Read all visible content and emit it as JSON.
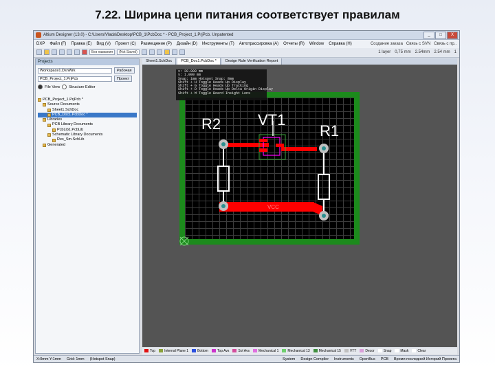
{
  "slide": {
    "title": "7.22. Ширина цепи питания соответствует правилам"
  },
  "window": {
    "title": "Altium Designer (13.0) - C:\\Users\\Vlada\\Desktop\\PCB_1\\PcbDoc * - PCB_Project_1.PrjPcb. Unpatented",
    "controls": [
      "_",
      "□",
      "X"
    ]
  },
  "menu": {
    "items": [
      "DXP",
      "Файл (F)",
      "Правка (E)",
      "Вид (V)",
      "Проект (C)",
      "Размещение (P)",
      "Дизайн (D)",
      "Инструменты (T)",
      "Автотрассировка (A)",
      "Отчеты (R)",
      "Window",
      "Справка (H)"
    ],
    "right": [
      "Создание заказа",
      "Связь с SVN",
      "Связь с пр.."
    ]
  },
  "toolbar": {
    "select1": "Без названия",
    "select2": "(Not Saved)",
    "right": [
      "1 layer",
      "0,75 mm",
      "2.54mm",
      "2.54 mm",
      "1"
    ]
  },
  "projects_panel": {
    "header": "Projects",
    "workspace_value": "Workspace1.DsnWrk",
    "workspace_button": "Рабочая",
    "project_value": "PCB_Project_1.PrjPcb",
    "project_button": "Проект",
    "view_file": "File View",
    "view_structure": "Structure Editor",
    "tree": [
      {
        "label": "PCB_Project_1.PrjPcb *",
        "indent": 0,
        "selected": false
      },
      {
        "label": "Source Documents",
        "indent": 1,
        "selected": false
      },
      {
        "label": "Sheet1.SchDoc",
        "indent": 2,
        "selected": false
      },
      {
        "label": "PCB_Doc1.PcbDoc *",
        "indent": 2,
        "selected": true
      },
      {
        "label": "Libraries",
        "indent": 1,
        "selected": false
      },
      {
        "label": "PCB Library Documents",
        "indent": 2,
        "selected": false
      },
      {
        "label": "PcbLib1.PcbLib",
        "indent": 3,
        "selected": false
      },
      {
        "label": "Schematic Library Documents",
        "indent": 2,
        "selected": false
      },
      {
        "label": "Res_Sm.SchLib",
        "indent": 3,
        "selected": false
      },
      {
        "label": "Generated",
        "indent": 1,
        "selected": false
      }
    ]
  },
  "editor": {
    "tabs": [
      {
        "label": "Sheet1.SchDoc",
        "active": false
      },
      {
        "label": "PCB_Doc1.PcbDoc *",
        "active": true
      },
      {
        "label": "Design Rule Verification Report",
        "active": false
      }
    ],
    "hud": [
      "x: 20.000 mm",
      "y: 1.000 mm",
      "Snap: 1mm Hotspot Snap: 8mm",
      "Shift + H   Toggle Heads Up Display",
      "Shift + G   Toggle Heads Up Tracking",
      "Shift + D   Toggle Heads Up Delta Origin Display",
      "Shift + M   Toggle Board Insight Lens"
    ],
    "pcb": {
      "labels": {
        "r2": "R2",
        "vt1": "VT1",
        "r1": "R1",
        "net": "VCC"
      },
      "colors": {
        "board_edge": "#1c8a1c",
        "top_layer": "#ff0000",
        "silkscreen": "#ffffff",
        "pad": "#c0c0c0",
        "via_hole": "#2a8f8f",
        "selection": "#ff00ff"
      }
    }
  },
  "layers": [
    {
      "label": "Top",
      "color": "#e01010"
    },
    {
      "label": "Internal Plane 1",
      "color": "#8aa13a"
    },
    {
      "label": "Bottom",
      "color": "#2a4fe0"
    },
    {
      "label": "Top Avs",
      "color": "#cc33cc"
    },
    {
      "label": "Sol Avs",
      "color": "#d44d9c"
    },
    {
      "label": "Mechanical 1",
      "color": "#e070e0"
    },
    {
      "label": "Mechanical 13",
      "color": "#6ecf6e"
    },
    {
      "label": "Mechanical 15",
      "color": "#3f8f3f"
    },
    {
      "label": "VTT",
      "color": "#c0c0c0"
    },
    {
      "label": "Decor",
      "color": "#d9a0d9"
    },
    {
      "label": "Snap",
      "color": "#ffffff"
    },
    {
      "label": "Mask",
      "color": "#ffffff"
    },
    {
      "label": "Clear",
      "color": "#ffffff"
    }
  ],
  "status": {
    "left": [
      "X:0mm Y:1mm",
      "Grid: 1mm",
      "(Hotspot Snap)"
    ],
    "right": [
      "System",
      "Design Compiler",
      "Instruments",
      "OpenBus",
      "PCB",
      "Время последней Историй Проекта"
    ]
  }
}
